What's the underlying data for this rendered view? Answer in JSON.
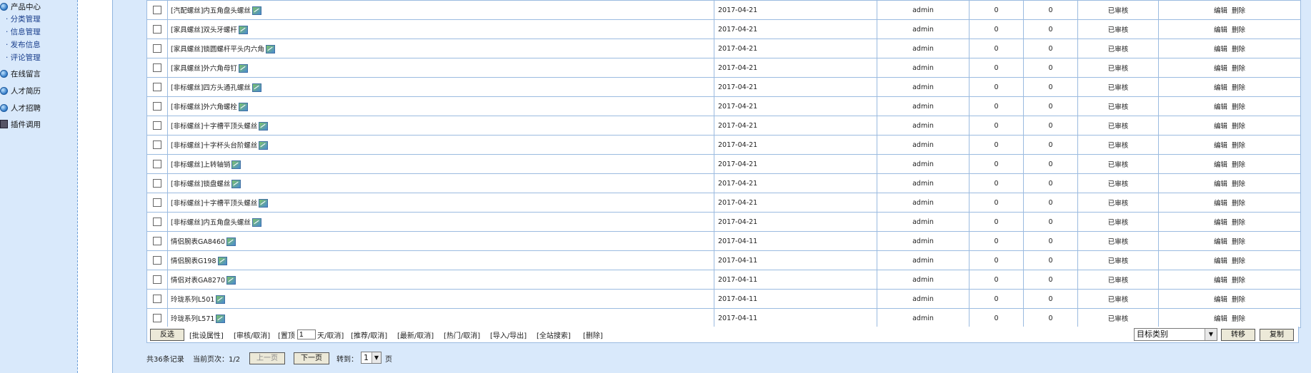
{
  "sidebar": {
    "group_product": "产品中心",
    "sub_items": [
      "· 分类管理",
      "· 信息管理",
      "· 发布信息",
      "· 评论管理"
    ],
    "groups": [
      "在线留言",
      "人才简历",
      "人才招聘",
      "插件调用"
    ],
    "icons": [
      "globe-icon",
      "globe-icon",
      "globe-icon",
      "globe-icon",
      "plugin-icon"
    ]
  },
  "table": {
    "rows": [
      {
        "title": "[汽配螺丝]内五角盘头螺丝",
        "date": "2017-04-21",
        "user": "admin",
        "n1": "0",
        "n2": "0",
        "status": "已审核"
      },
      {
        "title": "[家具螺丝]双头牙螺杆",
        "date": "2017-04-21",
        "user": "admin",
        "n1": "0",
        "n2": "0",
        "status": "已审核"
      },
      {
        "title": "[家具螺丝]锁圆螺杆平头内六角",
        "date": "2017-04-21",
        "user": "admin",
        "n1": "0",
        "n2": "0",
        "status": "已审核"
      },
      {
        "title": "[家具螺丝]外六角母钉",
        "date": "2017-04-21",
        "user": "admin",
        "n1": "0",
        "n2": "0",
        "status": "已审核"
      },
      {
        "title": "[非标螺丝]四方头通孔螺丝",
        "date": "2017-04-21",
        "user": "admin",
        "n1": "0",
        "n2": "0",
        "status": "已审核"
      },
      {
        "title": "[非标螺丝]外六角螺栓",
        "date": "2017-04-21",
        "user": "admin",
        "n1": "0",
        "n2": "0",
        "status": "已审核"
      },
      {
        "title": "[非标螺丝]十字槽平顶头螺丝",
        "date": "2017-04-21",
        "user": "admin",
        "n1": "0",
        "n2": "0",
        "status": "已审核"
      },
      {
        "title": "[非标螺丝]十字杯头台阶螺丝",
        "date": "2017-04-21",
        "user": "admin",
        "n1": "0",
        "n2": "0",
        "status": "已审核"
      },
      {
        "title": "[非标螺丝]上转轴销",
        "date": "2017-04-21",
        "user": "admin",
        "n1": "0",
        "n2": "0",
        "status": "已审核"
      },
      {
        "title": "[非标螺丝]锁盘螺丝",
        "date": "2017-04-21",
        "user": "admin",
        "n1": "0",
        "n2": "0",
        "status": "已审核"
      },
      {
        "title": "[非标螺丝]十字槽平顶头螺丝",
        "date": "2017-04-21",
        "user": "admin",
        "n1": "0",
        "n2": "0",
        "status": "已审核"
      },
      {
        "title": "[非标螺丝]内五角盘头螺丝",
        "date": "2017-04-21",
        "user": "admin",
        "n1": "0",
        "n2": "0",
        "status": "已审核"
      },
      {
        "title": "情侣腕表GA8460",
        "date": "2017-04-11",
        "user": "admin",
        "n1": "0",
        "n2": "0",
        "status": "已审核"
      },
      {
        "title": "情侣腕表G198",
        "date": "2017-04-11",
        "user": "admin",
        "n1": "0",
        "n2": "0",
        "status": "已审核"
      },
      {
        "title": "情侣对表GA8270",
        "date": "2017-04-11",
        "user": "admin",
        "n1": "0",
        "n2": "0",
        "status": "已审核"
      },
      {
        "title": "玲珑系列L501",
        "date": "2017-04-11",
        "user": "admin",
        "n1": "0",
        "n2": "0",
        "status": "已审核"
      },
      {
        "title": "玲珑系列L571",
        "date": "2017-04-11",
        "user": "admin",
        "n1": "0",
        "n2": "0",
        "status": "已审核"
      }
    ],
    "edit_label": "编辑",
    "delete_label": "删除"
  },
  "toolbar": {
    "invert_label": "反选",
    "actions": [
      "[批设属性]",
      "[审核/取消]",
      "[置顶",
      "天/取消]",
      "[推荐/取消]",
      "[最新/取消]",
      "[热门/取消]",
      "[导入/导出]",
      "[全站搜索]",
      "[删除]"
    ],
    "pin_days": "1",
    "target_category": "目标类别",
    "move_label": "转移",
    "copy_label": "复制"
  },
  "pager": {
    "total_text": "共36条记录",
    "current_text": "当前页次：1/2",
    "prev_label": "上一页",
    "next_label": "下一页",
    "goto_label": "转到：",
    "page_value": "1",
    "page_suffix": "页"
  }
}
